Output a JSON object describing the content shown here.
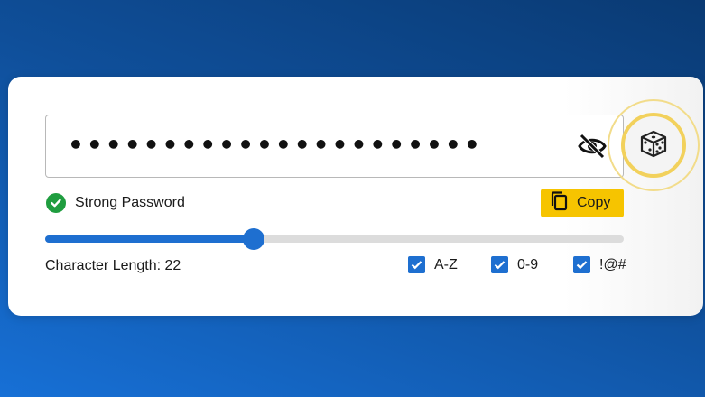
{
  "password": {
    "value": "••••••••••••••••••••••",
    "visibility_icon": "eye-off-icon"
  },
  "generate_button": {
    "icon": "dice-icon"
  },
  "status": {
    "text": "Strong Password",
    "icon": "check-circle-icon",
    "color": "#1f9d3f"
  },
  "copy_button": {
    "label": "Copy",
    "icon": "copy-icon",
    "color": "#f6c400"
  },
  "length": {
    "label": "Character Length: 22",
    "value": 22,
    "slider_fraction": 0.36
  },
  "options": [
    {
      "label": "A-Z",
      "checked": true
    },
    {
      "label": "0-9",
      "checked": true
    },
    {
      "label": "!@#",
      "checked": true
    }
  ],
  "colors": {
    "accent": "#1e6fd0",
    "track": "#dcdcdc"
  }
}
